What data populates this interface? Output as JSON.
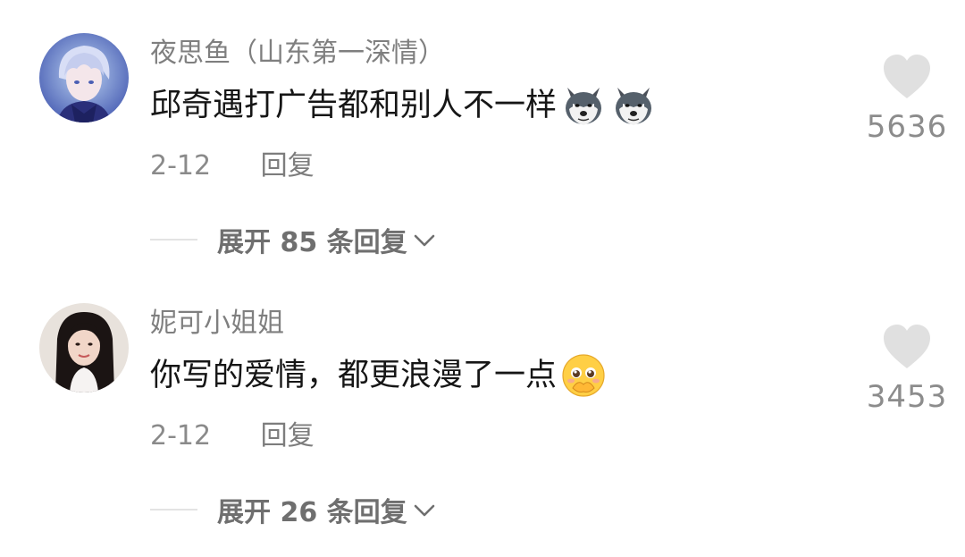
{
  "comments": [
    {
      "username": "夜思鱼（山东第一深情）",
      "text": "邱奇遇打广告都和别人不一样",
      "emojis": [
        "husky-dog-emoji",
        "husky-dog-emoji"
      ],
      "date": "2-12",
      "reply_label": "回复",
      "expand_label": "展开 85 条回复",
      "likes": "5636"
    },
    {
      "username": "妮可小姐姐",
      "text": "你写的爱情，都更浪漫了一点",
      "emojis": [
        "pleading-face-emoji"
      ],
      "date": "2-12",
      "reply_label": "回复",
      "expand_label": "展开 26 条回复",
      "likes": "3453"
    }
  ],
  "colors": {
    "text": "#161616",
    "secondary": "#7f7f7f",
    "heart": "#e0e0e0",
    "background": "#ffffff"
  }
}
